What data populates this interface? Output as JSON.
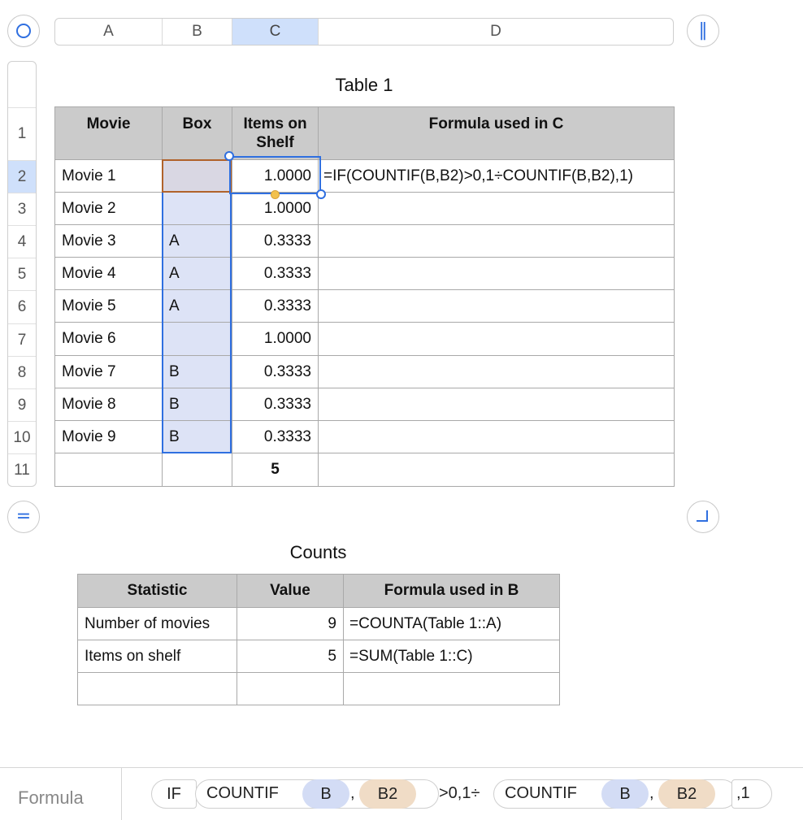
{
  "column_headers": [
    "A",
    "B",
    "C",
    "D"
  ],
  "row_headers": [
    "1",
    "2",
    "3",
    "4",
    "5",
    "6",
    "7",
    "8",
    "9",
    "10",
    "11"
  ],
  "table1": {
    "title": "Table 1",
    "headers": [
      "Movie",
      "Box",
      "Items on Shelf",
      "Formula used in C"
    ],
    "rows": [
      [
        "Movie 1",
        "",
        "1.0000",
        "=IF(COUNTIF(B,B2)>0,1÷COUNTIF(B,B2),1)"
      ],
      [
        "Movie 2",
        "",
        "1.0000",
        ""
      ],
      [
        "Movie 3",
        "A",
        "0.3333",
        ""
      ],
      [
        "Movie 4",
        "A",
        "0.3333",
        ""
      ],
      [
        "Movie 5",
        "A",
        "0.3333",
        ""
      ],
      [
        "Movie 6",
        "",
        "1.0000",
        ""
      ],
      [
        "Movie 7",
        "B",
        "0.3333",
        ""
      ],
      [
        "Movie 8",
        "B",
        "0.3333",
        ""
      ],
      [
        "Movie 9",
        "B",
        "0.3333",
        ""
      ]
    ],
    "footer": [
      "",
      "",
      "5",
      ""
    ]
  },
  "table2": {
    "title": "Counts",
    "headers": [
      "Statistic",
      "Value",
      "Formula used in B"
    ],
    "rows": [
      [
        "Number of movies",
        "9",
        "=COUNTA(Table 1::A)"
      ],
      [
        "Items on shelf",
        "5",
        "=SUM(Table 1::C)"
      ],
      [
        "",
        "",
        ""
      ]
    ]
  },
  "formula_bar": {
    "label": "Formula",
    "tokens": [
      "IF",
      "COUNTIF",
      "B",
      ",",
      "B2",
      ">0,1÷",
      "COUNTIF",
      "B",
      ",",
      "B2",
      ",1"
    ]
  },
  "icons": {
    "select_all": "circle-icon",
    "freeze_columns": "pause-bars-icon",
    "freeze_rows": "equals-icon",
    "resize": "corner-icon"
  },
  "colors": {
    "accent": "#2f6fe0",
    "selection_fill": "#cfe0fb",
    "box_column_fill": "#dde3f6",
    "ref_b": "#d3dcf5",
    "ref_b2": "#f0dcc6",
    "header_fill": "#cbcbcb"
  }
}
